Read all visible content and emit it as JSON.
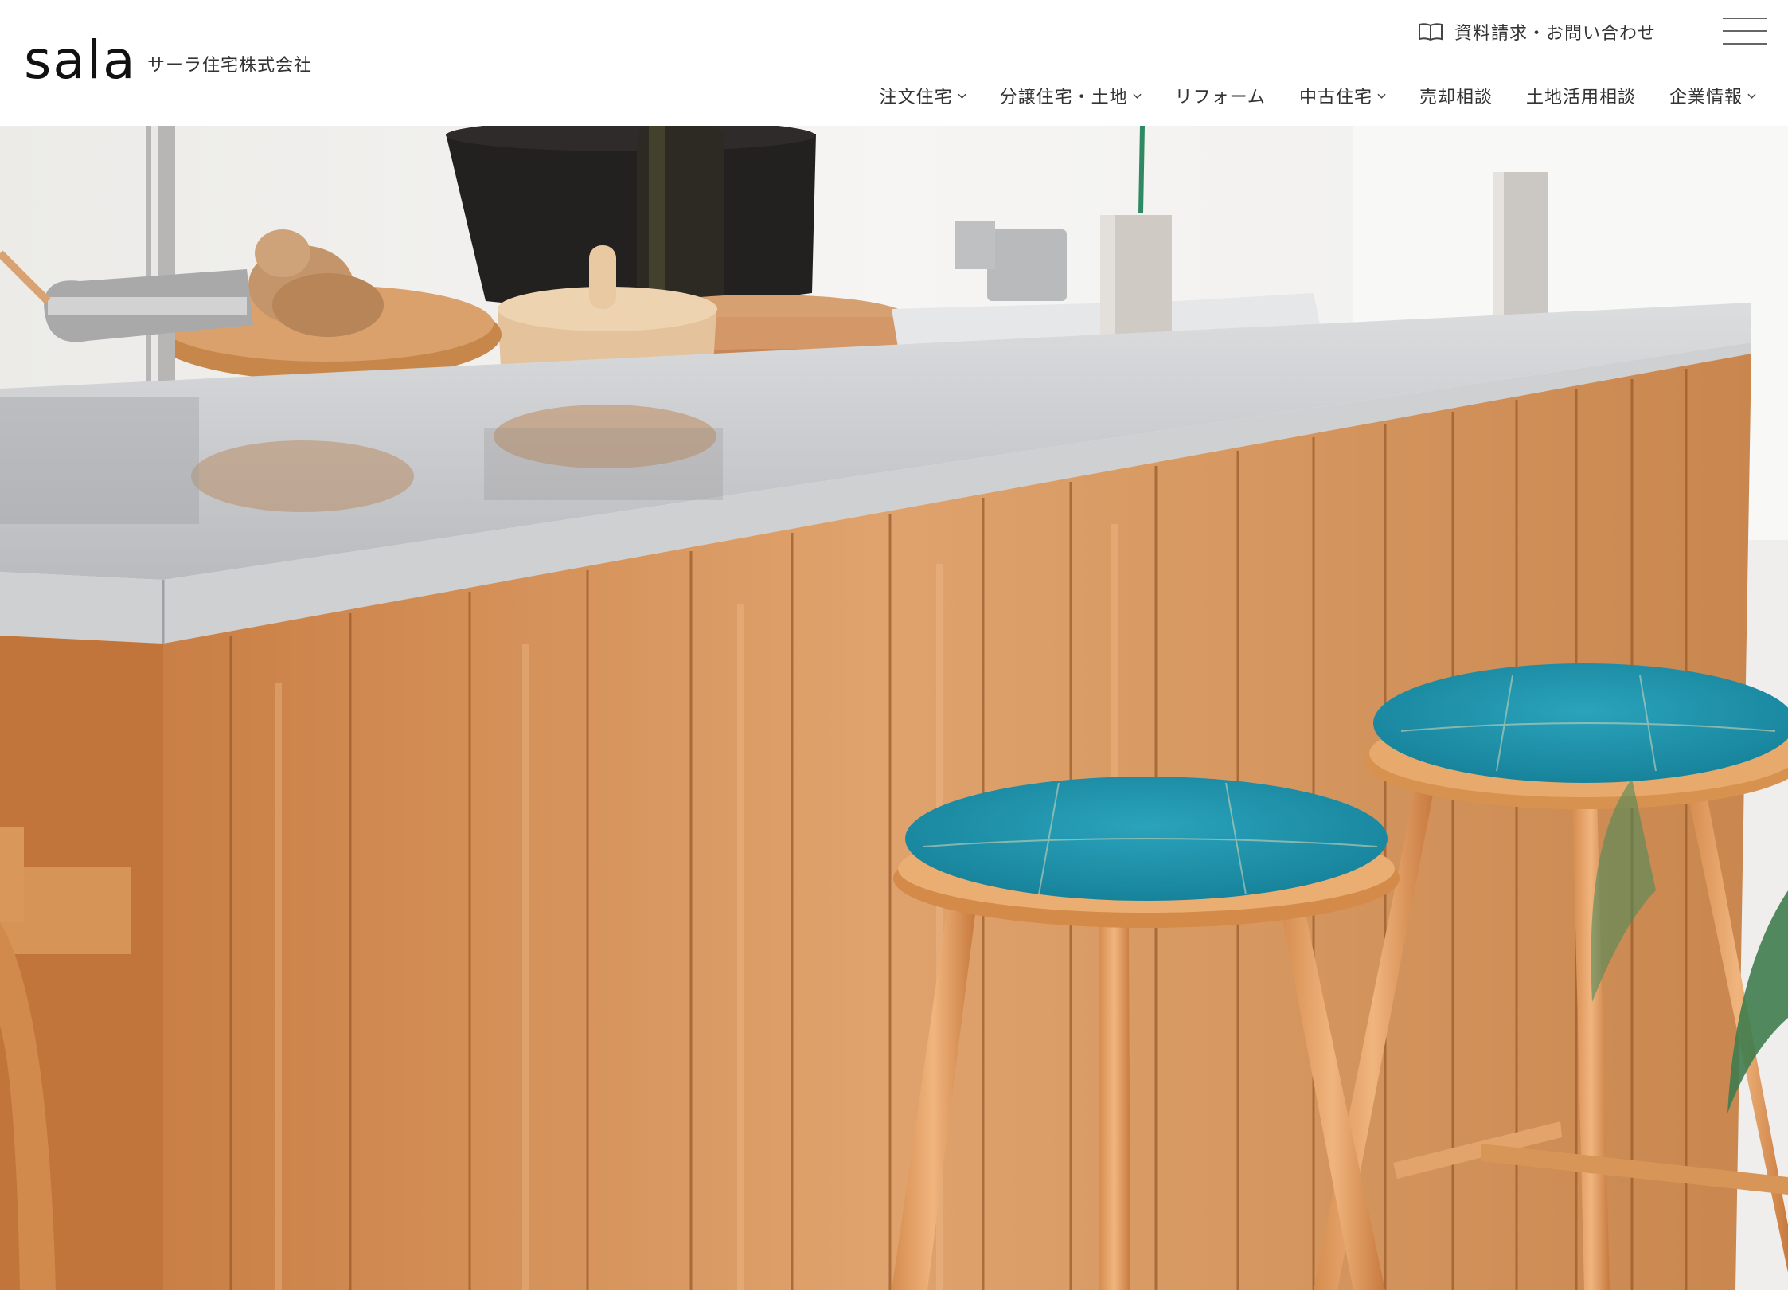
{
  "brand": {
    "logo_text": "sala",
    "company_name": "サーラ住宅株式会社"
  },
  "header": {
    "contact_label": "資料請求・お問い合わせ"
  },
  "nav": {
    "items": [
      {
        "label": "注文住宅",
        "has_dropdown": true
      },
      {
        "label": "分譲住宅・土地",
        "has_dropdown": true
      },
      {
        "label": "リフォーム",
        "has_dropdown": false
      },
      {
        "label": "中古住宅",
        "has_dropdown": true
      },
      {
        "label": "売却相談",
        "has_dropdown": false
      },
      {
        "label": "土地活用相談",
        "has_dropdown": false
      },
      {
        "label": "企業情報",
        "has_dropdown": true
      }
    ]
  },
  "icons": {
    "contact": "book-icon",
    "menu": "hamburger-menu-icon",
    "dropdown": "chevron-down-icon"
  },
  "colors": {
    "text": "#333333",
    "stool_seat": "#1f93ab",
    "wood": "#d9965a",
    "counter": "#c9cbcd"
  }
}
